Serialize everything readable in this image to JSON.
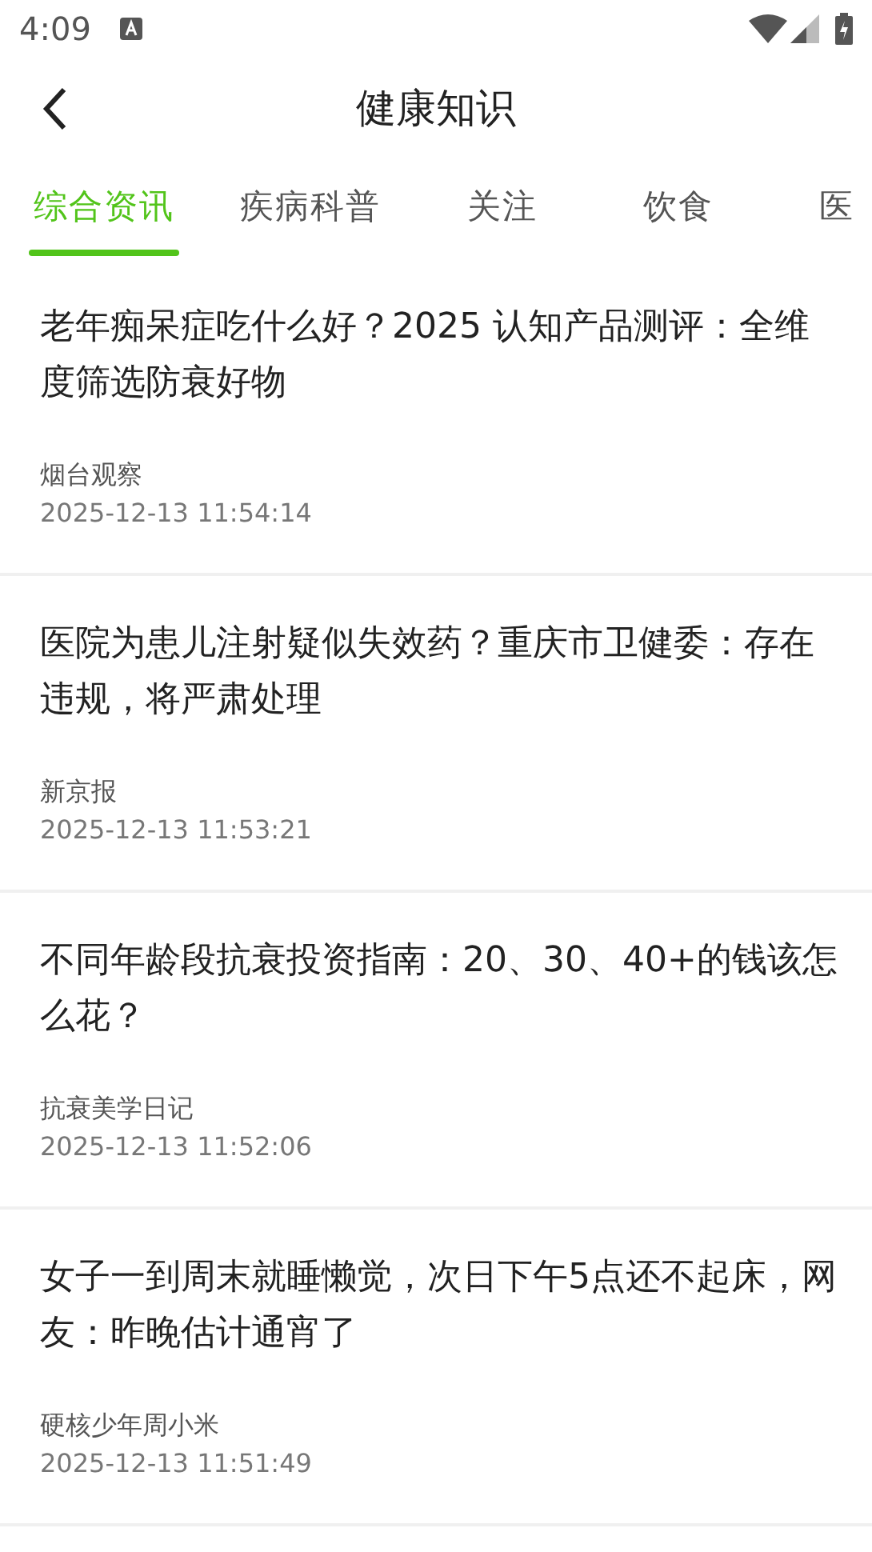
{
  "status_bar": {
    "time": "4:09"
  },
  "header": {
    "title": "健康知识"
  },
  "tabs": [
    {
      "label": "综合资讯",
      "selected": true
    },
    {
      "label": "疾病科普",
      "selected": false
    },
    {
      "label": "关注",
      "selected": false
    },
    {
      "label": "饮食",
      "selected": false
    },
    {
      "label": "医",
      "selected": false
    }
  ],
  "articles": [
    {
      "title": "老年痴呆症吃什么好？2025 认知产品测评：全维度筛选防衰好物",
      "source": "烟台观察",
      "time": "2025-12-13 11:54:14"
    },
    {
      "title": "医院为患儿注射疑似失效药？重庆市卫健委：存在违规，将严肃处理",
      "source": "新京报",
      "time": "2025-12-13 11:53:21"
    },
    {
      "title": "不同年龄段抗衰投资指南：20、30、40+的钱该怎么花？",
      "source": "抗衰美学日记",
      "time": "2025-12-13 11:52:06"
    },
    {
      "title": "女子一到周末就睡懒觉，次日下午5点还不起床，网友：昨晚估计通宵了",
      "source": "硬核少年周小米",
      "time": "2025-12-13 11:51:49"
    }
  ]
}
